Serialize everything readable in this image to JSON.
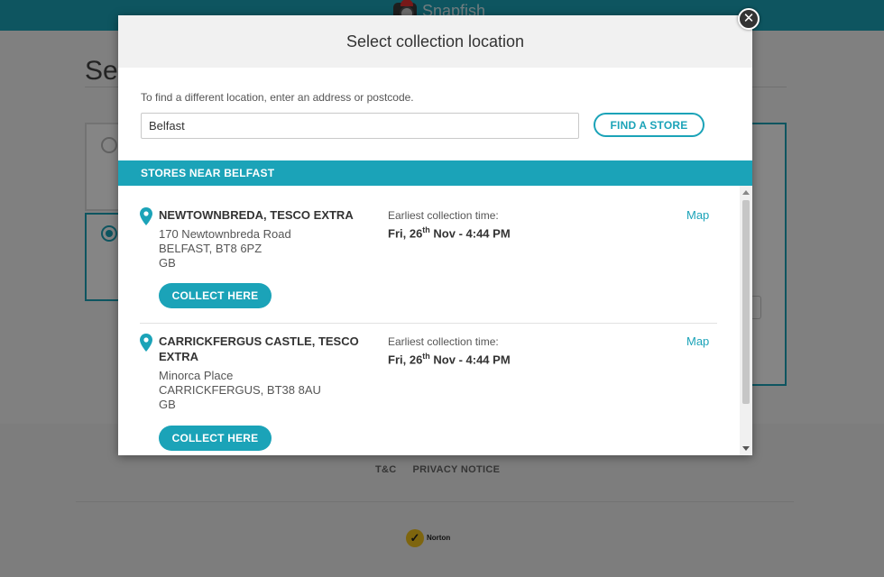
{
  "background": {
    "brand": "Snapfish",
    "page_title": "Sel",
    "footer_links": [
      "T&C",
      "PRIVACY NOTICE"
    ],
    "norton_text": "Norton"
  },
  "modal": {
    "title": "Select collection location",
    "close_icon": "close-icon",
    "search_hint": "To find a different location, enter an address or postcode.",
    "search_value": "Belfast",
    "find_button": "FIND A STORE",
    "stores_heading": "STORES NEAR BELFAST",
    "stores": [
      {
        "name": "NEWTOWNBREDA, TESCO EXTRA",
        "address_line1": "170 Newtownbreda Road",
        "address_line2": "BELFAST, BT8 6PZ",
        "country": "GB",
        "time_label": "Earliest collection time:",
        "time_day": "Fri, 26",
        "time_sup": "th",
        "time_rest": " Nov - 4:44 PM",
        "map_label": "Map",
        "collect_label": "COLLECT HERE"
      },
      {
        "name": "CARRICKFERGUS CASTLE, TESCO EXTRA",
        "address_line1": "Minorca Place",
        "address_line2": "CARRICKFERGUS, BT38 8AU",
        "country": "GB",
        "time_label": "Earliest collection time:",
        "time_day": "Fri, 26",
        "time_sup": "th",
        "time_rest": " Nov - 4:44 PM",
        "map_label": "Map",
        "collect_label": "COLLECT HERE"
      }
    ]
  },
  "colors": {
    "accent": "#1ba3b8",
    "overlay": "rgba(0,0,0,0.48)"
  }
}
